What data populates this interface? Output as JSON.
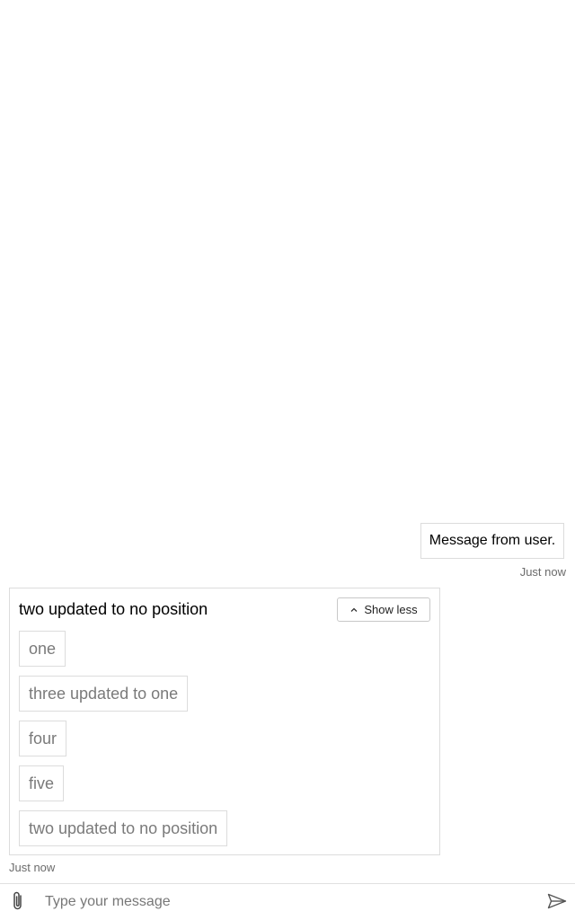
{
  "conversation": {
    "user_message": {
      "text": "Message from user.",
      "timestamp": "Just now"
    },
    "bot_message": {
      "title": "two updated to no position",
      "toggle_label": "Show less",
      "toggle_icon": "chevron-up-icon",
      "options": [
        "one",
        "three updated to one",
        "four",
        "five",
        "two updated to no position"
      ],
      "timestamp": "Just now"
    }
  },
  "composer": {
    "placeholder": "Type your message",
    "value": "",
    "attach_icon": "paperclip-icon",
    "send_icon": "send-icon"
  },
  "colors": {
    "border": "#dcdcdc",
    "option_text": "#7a7a7a",
    "timestamp_text": "#6b6b6b"
  }
}
